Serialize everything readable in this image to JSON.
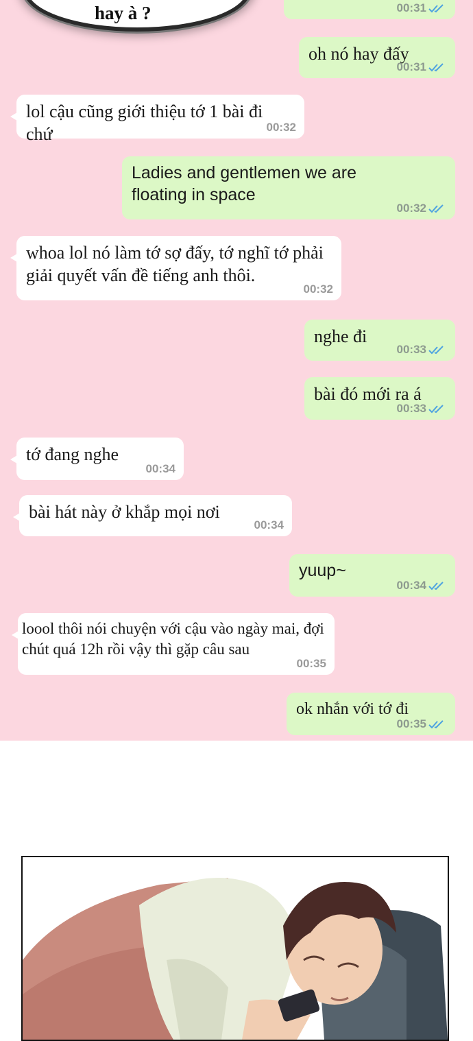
{
  "thought_bubble": {
    "text": "hay à ?"
  },
  "messages": [
    {
      "dir": "out",
      "text": "",
      "time": "00:31",
      "read": true
    },
    {
      "dir": "out",
      "text": "oh nó hay đấy",
      "time": "00:31",
      "read": true
    },
    {
      "dir": "in",
      "text": "lol cậu cũng giới thiệu tớ 1 bài đi chứ",
      "time": "00:32"
    },
    {
      "dir": "out",
      "text": "Ladies and gentlemen we are floating in space",
      "time": "00:32",
      "read": true
    },
    {
      "dir": "in",
      "text": "whoa lol nó làm tớ sợ đấy, tớ nghĩ tớ phải giải quyết vấn đề tiếng anh thôi.",
      "time": "00:32"
    },
    {
      "dir": "out",
      "text": "nghe đi",
      "time": "00:33",
      "read": true
    },
    {
      "dir": "out",
      "text": "bài đó mới ra á",
      "time": "00:33",
      "read": true
    },
    {
      "dir": "in",
      "text": "tớ đang nghe",
      "time": "00:34"
    },
    {
      "dir": "in",
      "text": "bài hát này ở khắp mọi nơi",
      "time": "00:34"
    },
    {
      "dir": "out",
      "text": "yuup~",
      "time": "00:34",
      "read": true
    },
    {
      "dir": "in",
      "text": "loool thôi nói chuyện với cậu vào ngày mai, đợi chút quá 12h rồi vậy thì gặp câu sau",
      "time": "00:35"
    },
    {
      "dir": "out",
      "text": "ok nhắn với tớ đi",
      "time": "00:35",
      "read": true
    }
  ],
  "colors": {
    "chat_background": "#fcd7e0",
    "incoming_bubble": "#ffffff",
    "outgoing_bubble": "#dcf8c6",
    "read_check": "#4fa3e0"
  },
  "illustration": {
    "subject": "person-lying-in-bed-with-phone-icon"
  }
}
